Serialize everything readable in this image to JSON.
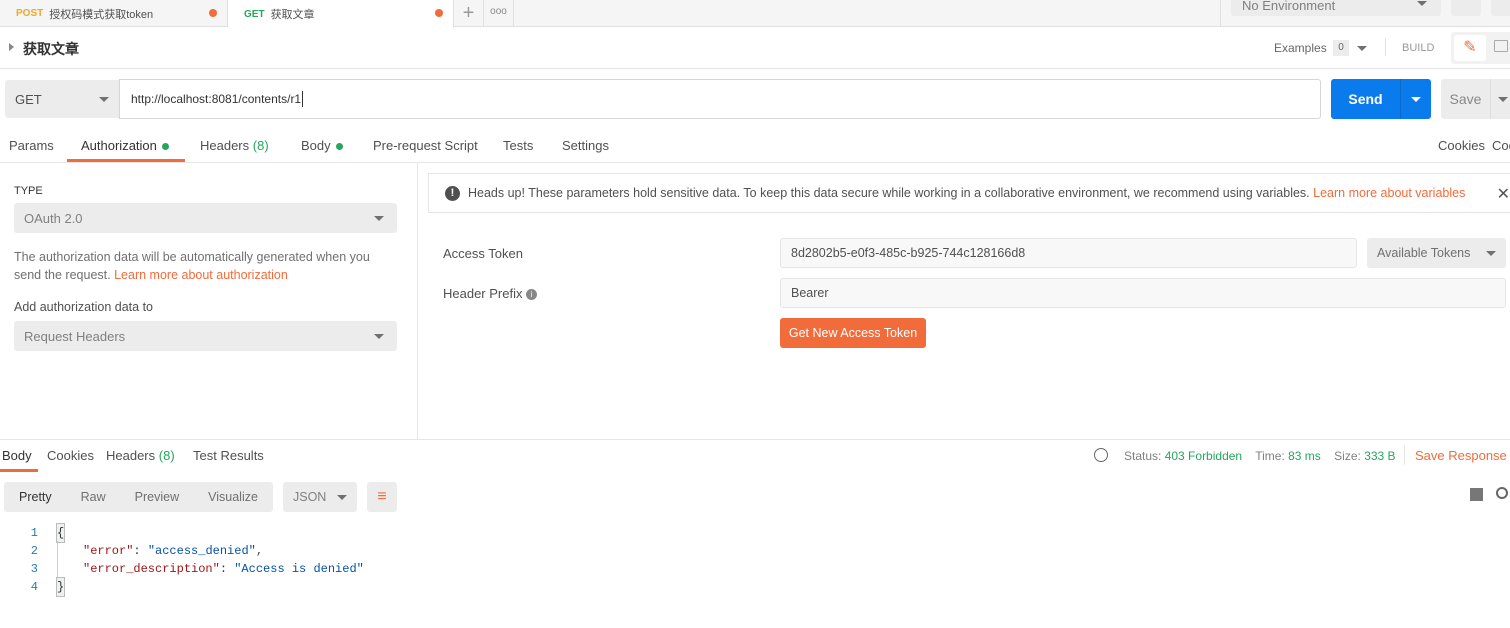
{
  "tabs": [
    {
      "method": "POST",
      "title": "授权码模式获取token"
    },
    {
      "method": "GET",
      "title": "获取文章"
    }
  ],
  "environment": "No Environment",
  "request_name": "获取文章",
  "examples_label": "Examples",
  "examples_count": "0",
  "build_label": "BUILD",
  "method": "GET",
  "url": "http://localhost:8081/contents/r1",
  "send_label": "Send",
  "save_label": "Save",
  "req_tabs": {
    "params": "Params",
    "authorization": "Authorization",
    "headers": "Headers",
    "headers_count": "(8)",
    "body": "Body",
    "prerequest": "Pre-request Script",
    "tests": "Tests",
    "settings": "Settings"
  },
  "cookies_link": "Cookies",
  "code_link": "Code",
  "auth": {
    "type_label": "TYPE",
    "type_value": "OAuth 2.0",
    "description": "The authorization data will be automatically generated when you send the request.",
    "learn_more": "Learn more about authorization",
    "add_to_label": "Add authorization data to",
    "add_to_value": "Request Headers"
  },
  "alert": {
    "text": "Heads up! These parameters hold sensitive data. To keep this data secure while working in a collaborative environment, we recommend using variables.",
    "link": "Learn more about variables"
  },
  "access_token_label": "Access Token",
  "access_token_value": "8d2802b5-e0f3-485c-b925-744c128166d8",
  "available_tokens": "Available Tokens",
  "header_prefix_label": "Header Prefix",
  "header_prefix_value": "Bearer",
  "get_token_label": "Get New Access Token",
  "resp_tabs": {
    "body": "Body",
    "cookies": "Cookies",
    "headers": "Headers",
    "headers_count": "(8)",
    "tests": "Test Results"
  },
  "status": {
    "status_label": "Status:",
    "status_value": "403 Forbidden",
    "time_label": "Time:",
    "time_value": "83 ms",
    "size_label": "Size:",
    "size_value": "333 B",
    "save_response": "Save Response"
  },
  "view_modes": [
    "Pretty",
    "Raw",
    "Preview",
    "Visualize"
  ],
  "format": "JSON",
  "response_lines": [
    {
      "n": "1",
      "text": "{"
    },
    {
      "n": "2",
      "key": "\"error\"",
      "value": "\"access_denied\"",
      "trail": ","
    },
    {
      "n": "3",
      "key": "\"error_description\"",
      "value": "\"Access is denied\"",
      "trail": ""
    },
    {
      "n": "4",
      "text": "}"
    }
  ]
}
